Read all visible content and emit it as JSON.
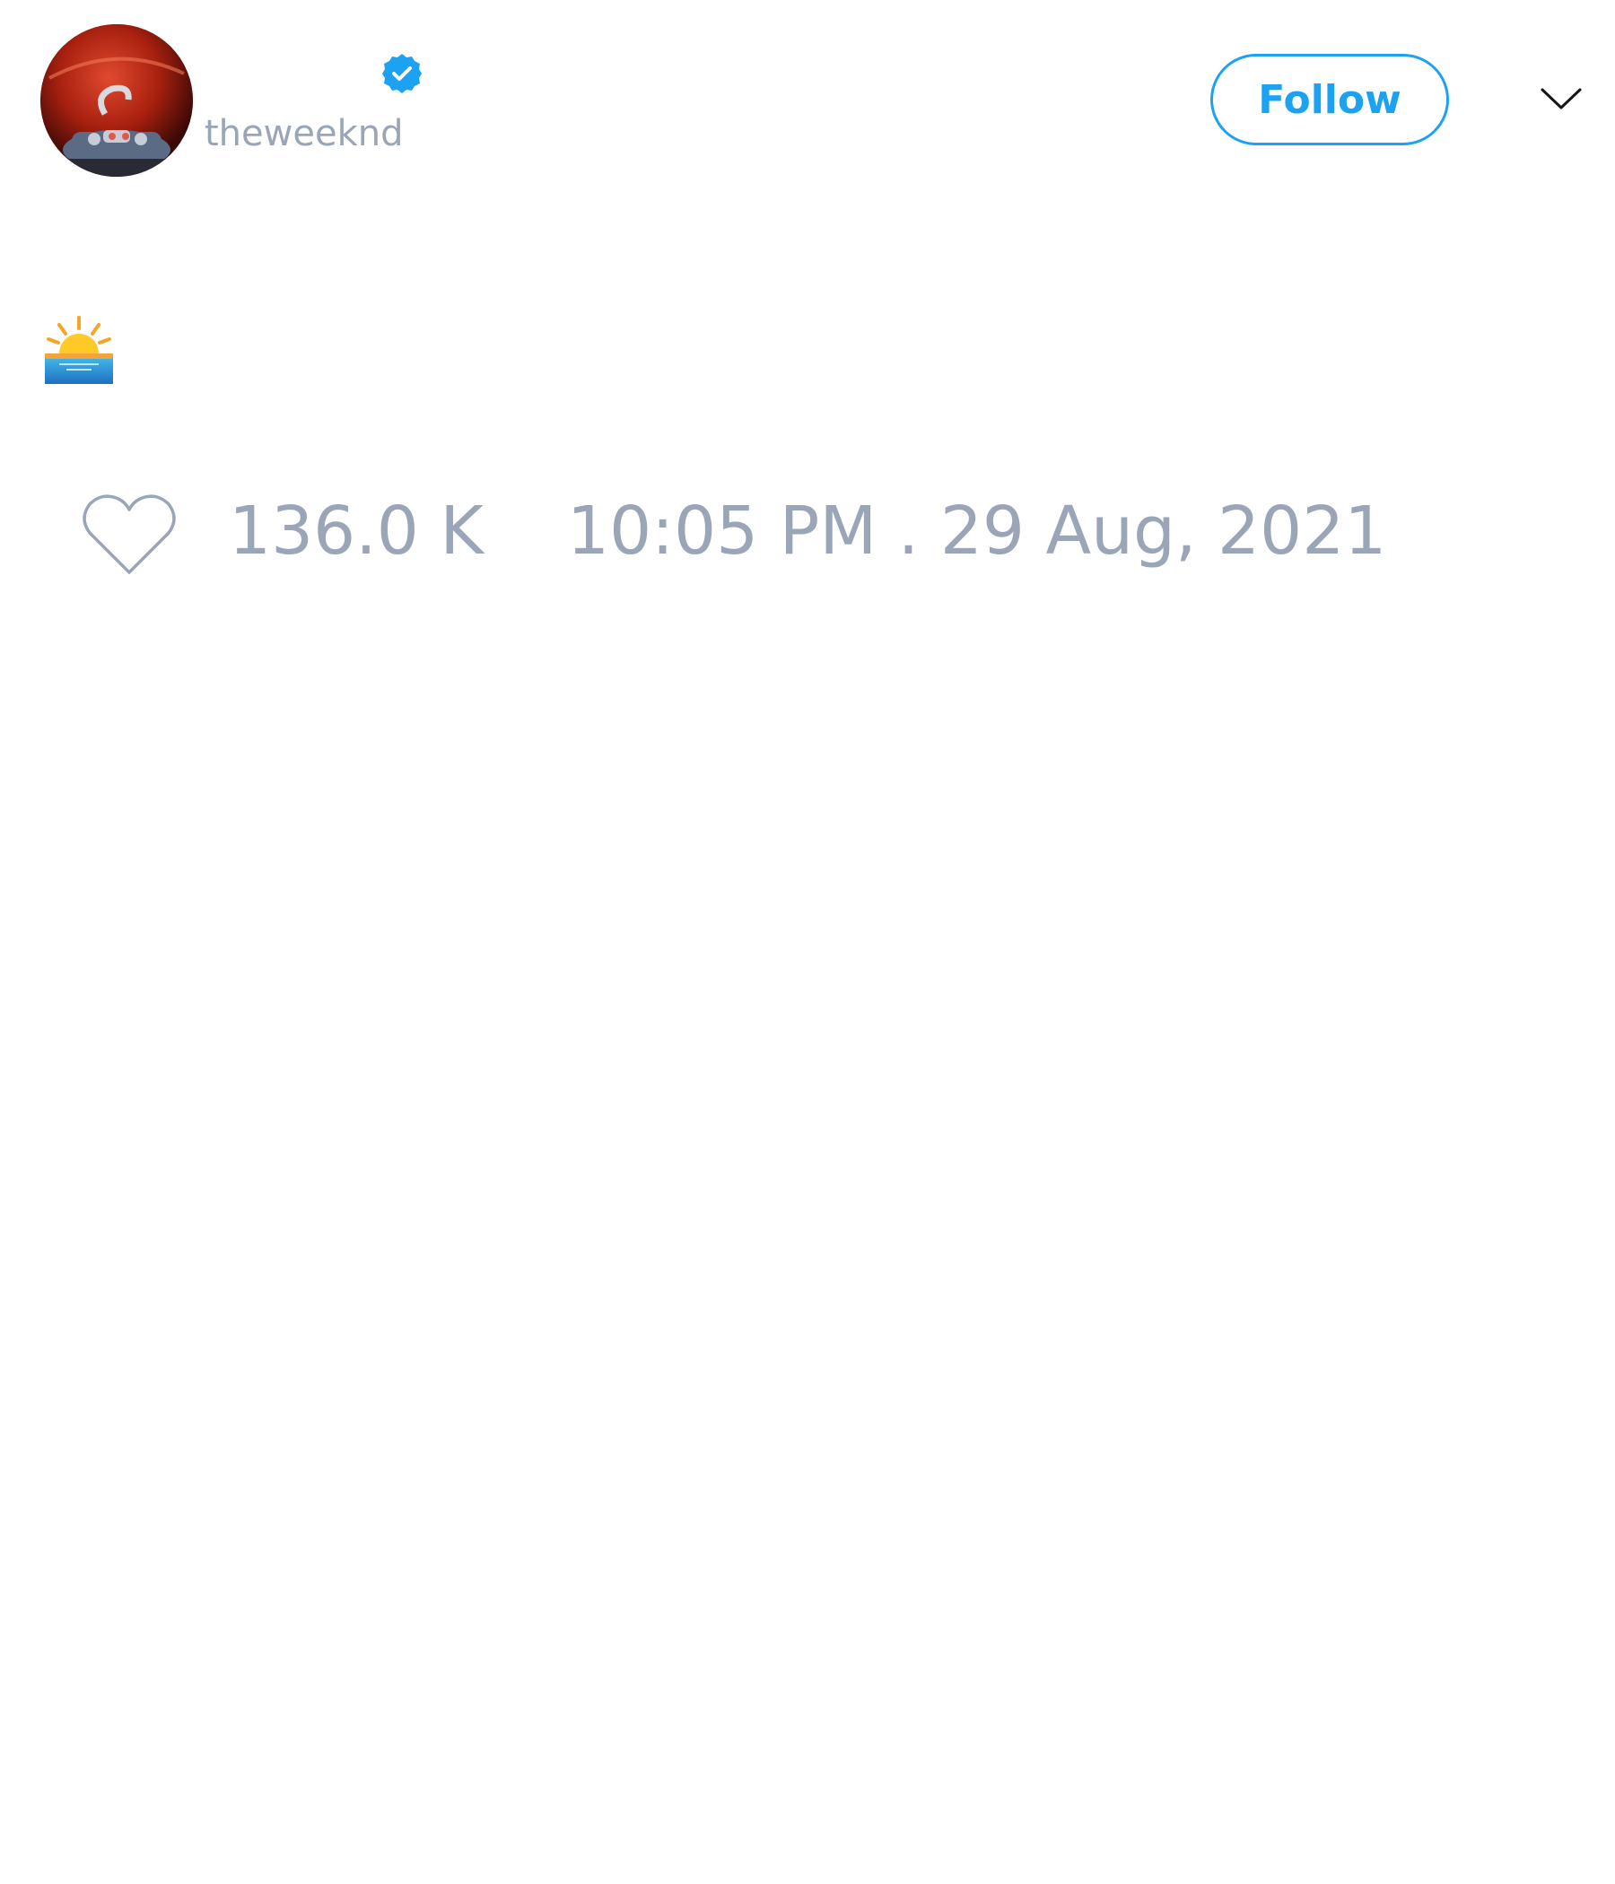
{
  "colors": {
    "accent": "#1da1f2",
    "muted_text": "#9aa6b8",
    "verified_badge": "#1da1f2"
  },
  "author": {
    "display_name": "",
    "handle": "theweeknd",
    "verified": true,
    "avatar_icon": "avatar-image"
  },
  "actions": {
    "follow_label": "Follow",
    "menu_icon": "chevron-down-icon"
  },
  "tweet": {
    "text_emoji": "sunrise-emoji",
    "like_icon": "heart-icon",
    "like_count": "136.0 K",
    "timestamp": "10:05 PM . 29 Aug, 2021"
  }
}
